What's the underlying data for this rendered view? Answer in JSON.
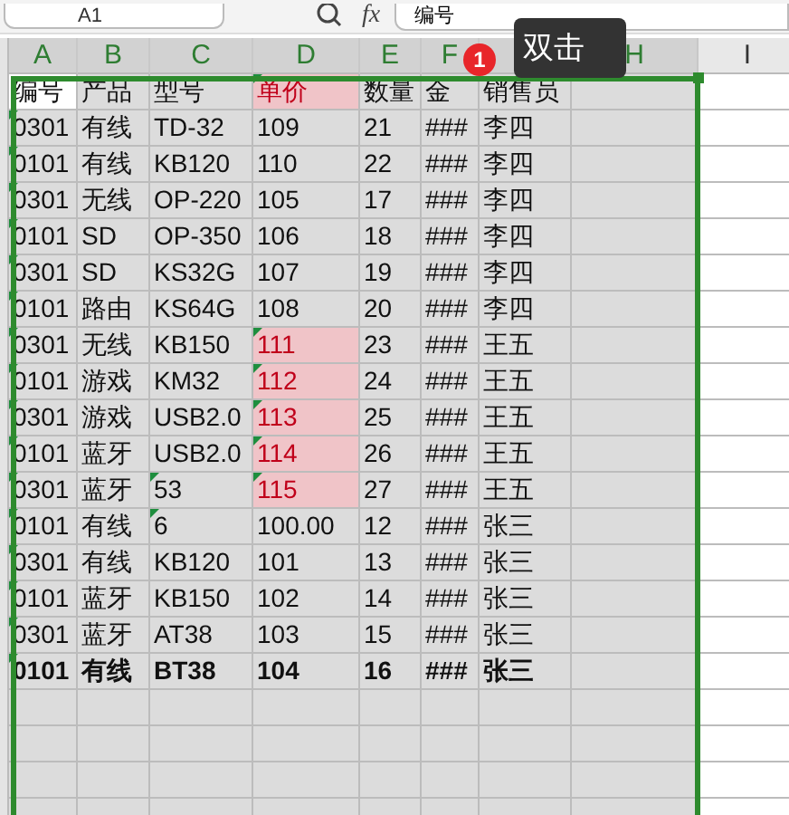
{
  "formula_bar": {
    "name_box": "A1",
    "formula_icon": "fx",
    "value": "编号"
  },
  "column_headers": [
    {
      "label": "A",
      "selected": true
    },
    {
      "label": "B",
      "selected": true
    },
    {
      "label": "C",
      "selected": true
    },
    {
      "label": "D",
      "selected": true
    },
    {
      "label": "E",
      "selected": true
    },
    {
      "label": "F",
      "selected": true
    },
    {
      "selected": true
    },
    {
      "label": "H",
      "selected": true
    },
    {
      "label": "I",
      "selected": false
    }
  ],
  "header_row": {
    "cells": [
      "编号",
      "产品",
      "型号",
      "单价",
      "数量",
      "金",
      "销售员"
    ],
    "price_alert": true,
    "active_cell": true
  },
  "rows": [
    {
      "cells": [
        "0301",
        "有线",
        "TD-32",
        "109",
        "21",
        "###",
        "李四"
      ],
      "code_marked": true,
      "model_marked": false,
      "price_alert": false,
      "bold": false
    },
    {
      "cells": [
        "0101",
        "有线",
        "KB120",
        "110",
        "22",
        "###",
        "李四"
      ],
      "code_marked": true,
      "model_marked": false,
      "price_alert": false,
      "bold": false
    },
    {
      "cells": [
        "0301",
        "无线",
        "OP-220",
        "105",
        "17",
        "###",
        "李四"
      ],
      "code_marked": true,
      "model_marked": false,
      "price_alert": false,
      "bold": false
    },
    {
      "cells": [
        "0101",
        "SD",
        "OP-350",
        "106",
        "18",
        "###",
        "李四"
      ],
      "code_marked": true,
      "model_marked": false,
      "price_alert": false,
      "bold": false
    },
    {
      "cells": [
        "0301",
        "SD",
        "KS32G",
        "107",
        "19",
        "###",
        "李四"
      ],
      "code_marked": true,
      "model_marked": false,
      "price_alert": false,
      "bold": false
    },
    {
      "cells": [
        "0101",
        "路由",
        "KS64G",
        "108",
        "20",
        "###",
        "李四"
      ],
      "code_marked": true,
      "model_marked": false,
      "price_alert": false,
      "bold": false
    },
    {
      "cells": [
        "0301",
        "无线",
        "KB150",
        "111",
        "23",
        "###",
        "王五"
      ],
      "code_marked": true,
      "model_marked": false,
      "price_alert": true,
      "bold": false
    },
    {
      "cells": [
        "0101",
        "游戏",
        "KM32",
        "112",
        "24",
        "###",
        "王五"
      ],
      "code_marked": true,
      "model_marked": false,
      "price_alert": true,
      "bold": false
    },
    {
      "cells": [
        "0301",
        "游戏",
        "USB2.0",
        "113",
        "25",
        "###",
        "王五"
      ],
      "code_marked": true,
      "model_marked": false,
      "price_alert": true,
      "bold": false
    },
    {
      "cells": [
        "0101",
        "蓝牙",
        "USB2.0",
        "114",
        "26",
        "###",
        "王五"
      ],
      "code_marked": true,
      "model_marked": false,
      "price_alert": true,
      "bold": false
    },
    {
      "cells": [
        "0301",
        "蓝牙",
        "53",
        "115",
        "27",
        "###",
        "王五"
      ],
      "code_marked": true,
      "model_marked": true,
      "price_alert": true,
      "bold": false
    },
    {
      "cells": [
        "0101",
        "有线",
        "6",
        "100.00",
        "12",
        "###",
        "张三"
      ],
      "code_marked": true,
      "model_marked": true,
      "price_alert": false,
      "bold": false
    },
    {
      "cells": [
        "0301",
        "有线",
        "KB120",
        "101",
        "13",
        "###",
        "张三"
      ],
      "code_marked": true,
      "model_marked": false,
      "price_alert": false,
      "bold": false
    },
    {
      "cells": [
        "0101",
        "蓝牙",
        "KB150",
        "102",
        "14",
        "###",
        "张三"
      ],
      "code_marked": true,
      "model_marked": false,
      "price_alert": false,
      "bold": false
    },
    {
      "cells": [
        "0301",
        "蓝牙",
        "AT38",
        "103",
        "15",
        "###",
        "张三"
      ],
      "code_marked": true,
      "model_marked": false,
      "price_alert": false,
      "bold": false
    },
    {
      "cells": [
        "0101",
        "有线",
        "BT38",
        "104",
        "16",
        "###",
        "张三"
      ],
      "code_marked": true,
      "model_marked": false,
      "price_alert": false,
      "bold": true
    }
  ],
  "tooltip": {
    "badge": "1",
    "text": "双击"
  }
}
